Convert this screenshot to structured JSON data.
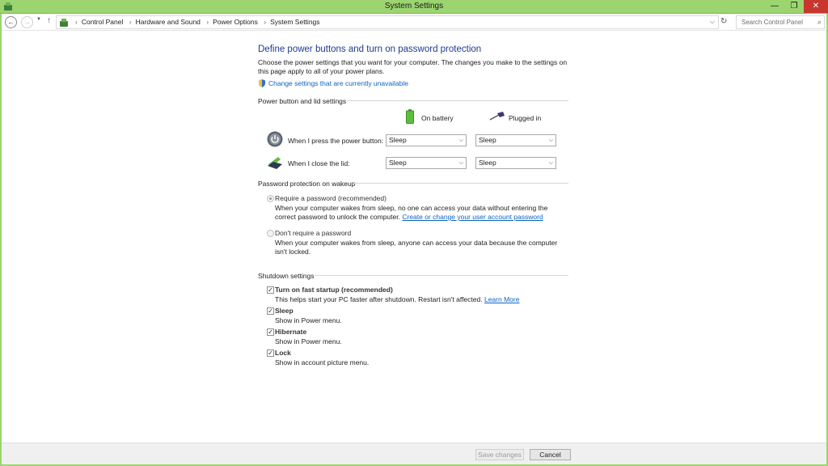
{
  "window": {
    "title": "System Settings",
    "minimize": "—",
    "maximize": "❐",
    "close": "✕"
  },
  "address": {
    "breadcrumbs": [
      "Control Panel",
      "Hardware and Sound",
      "Power Options",
      "System Settings"
    ],
    "search_placeholder": "Search Control Panel"
  },
  "page": {
    "title": "Define power buttons and turn on password protection",
    "intro": "Choose the power settings that you want for your computer. The changes you make to the settings on this page apply to all of your power plans.",
    "change_settings_link": "Change settings that are currently unavailable"
  },
  "power_section": {
    "label": "Power button and lid settings",
    "columns": [
      "On battery",
      "Plugged in"
    ],
    "rows": [
      {
        "label": "When I press the power button:",
        "battery": "Sleep",
        "plugged": "Sleep",
        "icon": "power-button-icon"
      },
      {
        "label": "When I close the lid:",
        "battery": "Sleep",
        "plugged": "Sleep",
        "icon": "laptop-lid-icon"
      }
    ]
  },
  "password_section": {
    "label": "Password protection on wakeup",
    "require": {
      "label": "Require a password (recommended)",
      "desc": "When your computer wakes from sleep, no one can access your data without entering the correct password to unlock the computer.",
      "link": "Create or change your user account password",
      "selected": true
    },
    "dont_require": {
      "label": "Don't require a password",
      "desc": "When your computer wakes from sleep, anyone can access your data because the computer isn't locked.",
      "selected": false
    }
  },
  "shutdown_section": {
    "label": "Shutdown settings",
    "options": [
      {
        "title": "Turn on fast startup (recommended)",
        "desc": "This helps start your PC faster after shutdown. Restart isn't affected.",
        "link": "Learn More",
        "checked": true
      },
      {
        "title": "Sleep",
        "desc": "Show in Power menu.",
        "checked": true
      },
      {
        "title": "Hibernate",
        "desc": "Show in Power menu.",
        "checked": true
      },
      {
        "title": "Lock",
        "desc": "Show in account picture menu.",
        "checked": true
      }
    ]
  },
  "footer": {
    "save": "Save changes",
    "cancel": "Cancel"
  },
  "colors": {
    "title_bar": "#9cd470",
    "title_text": "#1e3a8c",
    "link": "#0b63c4"
  }
}
